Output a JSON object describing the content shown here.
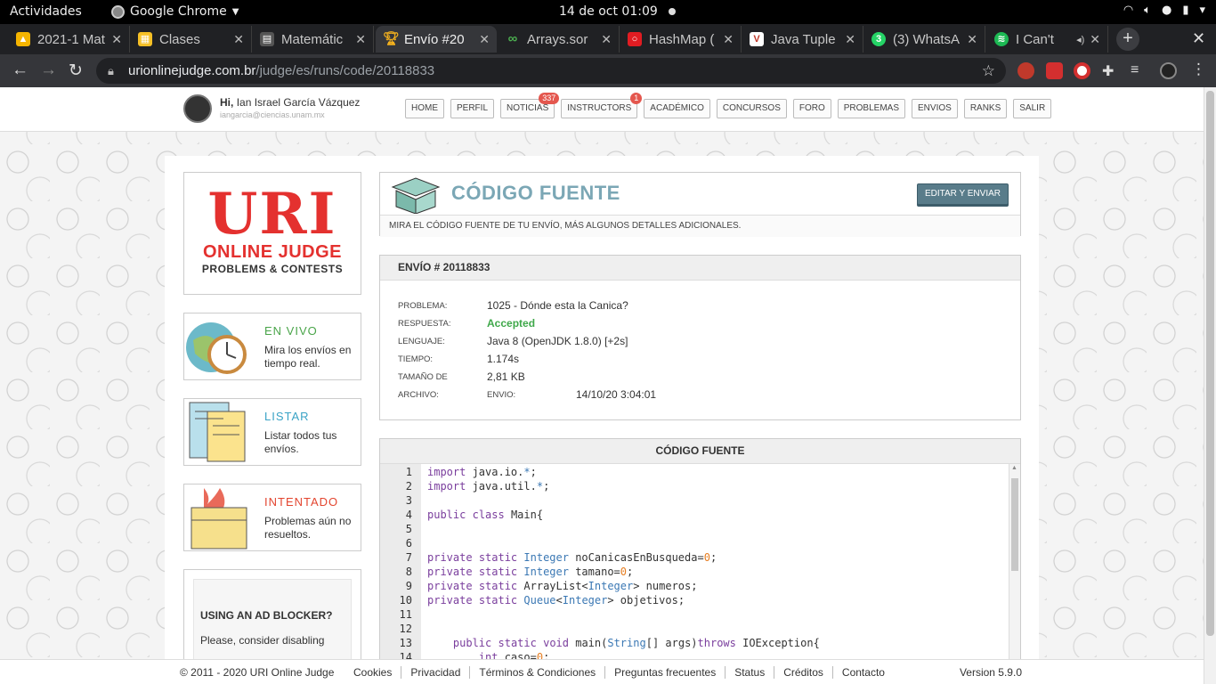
{
  "topbar": {
    "activities": "Actividades",
    "app": "Google Chrome",
    "clock": "14 de oct  01:09"
  },
  "tabs": [
    {
      "label": "2021-1 Mat",
      "icon": "google-drive-icon",
      "color": "#f4b400"
    },
    {
      "label": "Clases",
      "icon": "google-classroom-icon",
      "color": "#f6c026"
    },
    {
      "label": "Matemátic",
      "icon": "document-icon",
      "color": "#555555"
    },
    {
      "label": "Envío #20",
      "icon": "trophy-icon",
      "color": "#f2b01e"
    },
    {
      "label": "Arrays.sor",
      "icon": "infinity-icon",
      "color": "#4caf50"
    },
    {
      "label": "HashMap (",
      "icon": "oracle-icon",
      "color": "#e11c22"
    },
    {
      "label": "Java Tuple",
      "icon": "v-icon",
      "color": "#c0392b"
    },
    {
      "label": "(3) WhatsA",
      "icon": "whatsapp-icon",
      "color": "#25d366"
    },
    {
      "label": "I Can't",
      "icon": "spotify-icon",
      "color": "#1db954"
    }
  ],
  "address": {
    "domain": "urionlinejudge.com.br",
    "path": "/judge/es/runs/code/20118833"
  },
  "user": {
    "greeting": "Hi,",
    "name": "Ian Israel García Vázquez",
    "email": "iangarcia@ciencias.unam.mx"
  },
  "nav": [
    {
      "label": "HOME"
    },
    {
      "label": "PERFIL"
    },
    {
      "label": "NOTICIAS",
      "badge": "337"
    },
    {
      "label": "INSTRUCTORS",
      "badge": "1"
    },
    {
      "label": "ACADÉMICO"
    },
    {
      "label": "CONCURSOS"
    },
    {
      "label": "FORO"
    },
    {
      "label": "PROBLEMAS"
    },
    {
      "label": "ENVIOS"
    },
    {
      "label": "RANKS"
    },
    {
      "label": "SALIR"
    }
  ],
  "logo": {
    "main": "URI",
    "line1": "ONLINE JUDGE",
    "line2": "PROBLEMS & CONTESTS"
  },
  "sidebar": [
    {
      "title": "EN VIVO",
      "desc": "Mira los envíos en tiempo real.",
      "color": "#4aa54a"
    },
    {
      "title": "LISTAR",
      "desc": "Listar todos tus envíos.",
      "color": "#3aa3c6"
    },
    {
      "title": "INTENTADO",
      "desc": "Problemas aún no resueltos.",
      "color": "#e3452f"
    }
  ],
  "adblock": {
    "title": "USING AN AD BLOCKER?",
    "text": "Please, consider disabling"
  },
  "header": {
    "title": "CÓDIGO FUENTE",
    "edit_button": "EDITAR Y ENVIAR",
    "subtitle": "MIRA EL CÓDIGO FUENTE DE TU ENVÍO, MÁS ALGUNOS DETALLES ADICIONALES."
  },
  "submission": {
    "heading": "ENVÍO # 20118833",
    "problem_label": "PROBLEMA:",
    "problem": "1025 - Dónde esta la Canica?",
    "answer_label": "RESPUESTA:",
    "answer": "Accepted",
    "language_label": "LENGUAJE:",
    "language": "Java 8 (OpenJDK 1.8.0) [+2s]",
    "time_label": "TIEMPO:",
    "time": "1.174s",
    "size_label": "TAMAÑO DE",
    "size": "2,81 KB",
    "file_label": "ARCHIVO:",
    "sent_label": "ENVIO:",
    "sent": "14/10/20 3:04:01"
  },
  "code": {
    "heading": "CÓDIGO FUENTE",
    "lines": [
      {
        "n": "1",
        "text": "import java.io.*;"
      },
      {
        "n": "2",
        "text": "import java.util.*;"
      },
      {
        "n": "3",
        "text": ""
      },
      {
        "n": "4",
        "text": "public class Main{"
      },
      {
        "n": "5",
        "text": ""
      },
      {
        "n": "6",
        "text": ""
      },
      {
        "n": "7",
        "text": "private static Integer noCanicasEnBusqueda=0;"
      },
      {
        "n": "8",
        "text": "private static Integer tamano=0;"
      },
      {
        "n": "9",
        "text": "private static ArrayList<Integer> numeros;"
      },
      {
        "n": "10",
        "text": "private static Queue<Integer> objetivos;"
      },
      {
        "n": "11",
        "text": ""
      },
      {
        "n": "12",
        "text": ""
      },
      {
        "n": "13",
        "text": "    public static void main(String[] args)throws IOException{"
      },
      {
        "n": "14",
        "text": "        int caso=0;"
      }
    ]
  },
  "footer": {
    "copyright": "© 2011 - 2020 URI Online Judge",
    "links": [
      "Cookies",
      "Privacidad",
      "Términos & Condiciones",
      "Preguntas frecuentes",
      "Status",
      "Créditos",
      "Contacto"
    ],
    "version": "Version 5.9.0"
  }
}
